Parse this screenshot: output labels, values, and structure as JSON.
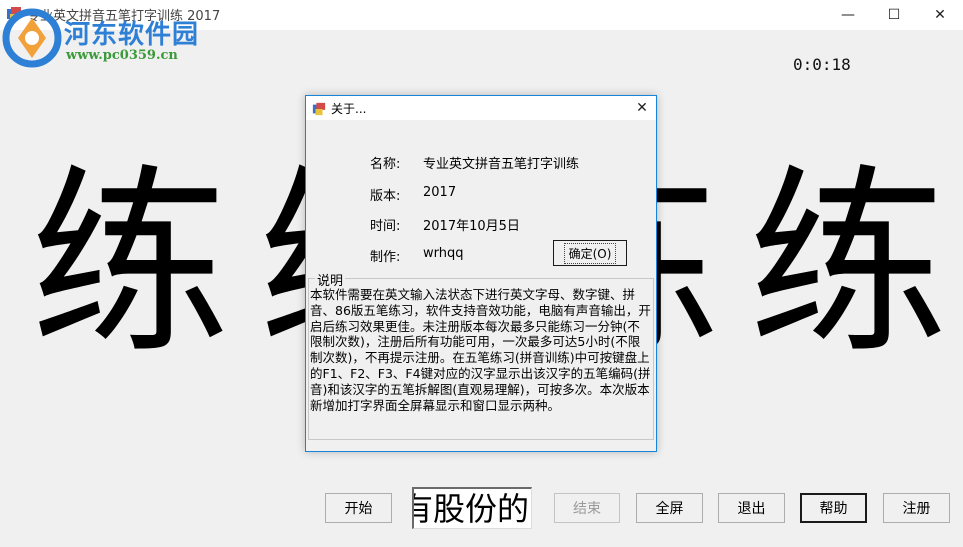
{
  "window": {
    "title": "专业英文拼音五笔打字训练 2017",
    "minimize": "—",
    "maximize": "☐",
    "close": "✕"
  },
  "watermark": {
    "line1": "河东软件园",
    "line2": "www.pc0359.cn"
  },
  "timer": "0:0:18",
  "practice_chars": [
    "练",
    "练",
    "练",
    "练"
  ],
  "input_text": "有股份的",
  "buttons": {
    "start": "开始",
    "end": "结束",
    "fullscreen": "全屏",
    "exit": "退出",
    "help": "帮助",
    "register": "注册"
  },
  "about_dialog": {
    "title": "关于...",
    "close": "✕",
    "name_label": "名称:",
    "name_value": "专业英文拼音五笔打字训练",
    "version_label": "版本:",
    "version_value": "2017",
    "time_label": "时间:",
    "time_value": "2017年10月5日",
    "author_label": "制作:",
    "author_value": "wrhqq",
    "ok_label": "确定(O)",
    "group_label": "说明",
    "description": "本软件需要在英文输入法状态下进行英文字母、数字键、拼音、86版五笔练习，软件支持音效功能，电脑有声音输出，开启后练习效果更佳。未注册版本每次最多只能练习一分钟(不限制次数)，注册后所有功能可用，一次最多可达5小时(不限制次数)，不再提示注册。在五笔练习(拼音训练)中可按键盘上的F1、F2、F3、F4键对应的汉字显示出该汉字的五笔编码(拼音)和该汉字的五笔拆解图(直观易理解)，可按多次。本次版本新增加打字界面全屏幕显示和窗口显示两种。"
  },
  "colors": {
    "accent": "#1883d7",
    "watermark_blue": "#2e7fd6",
    "watermark_green": "#3a9a3a"
  },
  "icons": [
    "app-icon",
    "minimize-icon",
    "maximize-icon",
    "close-icon",
    "watermark-logo-icon"
  ]
}
